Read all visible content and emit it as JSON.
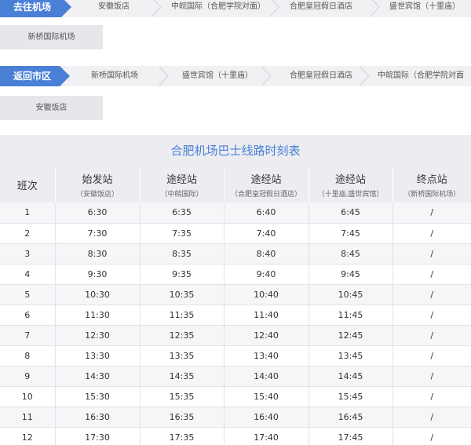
{
  "go_route": {
    "label": "去往机场",
    "stops": [
      "安徽饭店",
      "中皖国际（合肥学院对面）",
      "合肥皇冠假日酒店",
      "盛世宾馆（十里庙）"
    ],
    "final_stop": "新桥国际机场"
  },
  "back_route": {
    "label": "返回市区",
    "stops": [
      "新桥国际机场",
      "盛世宾馆（十里庙）",
      "合肥皇冠假日酒店",
      "中皖国际（合肥学院对面"
    ],
    "final_stop": "安徽饭店"
  },
  "timetable": {
    "title": "合肥机场巴士线路时刻表",
    "headers": [
      {
        "main": "班次",
        "sub": ""
      },
      {
        "main": "始发站",
        "sub": "（安徽饭店）"
      },
      {
        "main": "途经站",
        "sub": "（中皖国际）"
      },
      {
        "main": "途经站",
        "sub": "（合肥皇冠假日酒店）"
      },
      {
        "main": "途经站",
        "sub": "（十里庙,盛世宾馆）"
      },
      {
        "main": "终点站",
        "sub": "（新桥国际机场）"
      }
    ],
    "rows": [
      [
        "1",
        "6:30",
        "6:35",
        "6:40",
        "6:45",
        "/"
      ],
      [
        "2",
        "7:30",
        "7:35",
        "7:40",
        "7:45",
        "/"
      ],
      [
        "3",
        "8:30",
        "8:35",
        "8:40",
        "8:45",
        "/"
      ],
      [
        "4",
        "9:30",
        "9:35",
        "9:40",
        "9:45",
        "/"
      ],
      [
        "5",
        "10:30",
        "10:35",
        "10:40",
        "10:45",
        "/"
      ],
      [
        "6",
        "11:30",
        "11:35",
        "11:40",
        "11:45",
        "/"
      ],
      [
        "7",
        "12:30",
        "12:35",
        "12:40",
        "12:45",
        "/"
      ],
      [
        "8",
        "13:30",
        "13:35",
        "13:40",
        "13:45",
        "/"
      ],
      [
        "9",
        "14:30",
        "14:35",
        "14:40",
        "14:45",
        "/"
      ],
      [
        "10",
        "15:30",
        "15:35",
        "15:40",
        "15:45",
        "/"
      ],
      [
        "11",
        "16:30",
        "16:35",
        "16:40",
        "16:45",
        "/"
      ],
      [
        "12",
        "17:30",
        "17:35",
        "17:40",
        "17:45",
        "/"
      ]
    ]
  },
  "colors": {
    "accent": "#4a7fd6",
    "bar": "#f1f1f3",
    "header": "#ecedf1"
  }
}
